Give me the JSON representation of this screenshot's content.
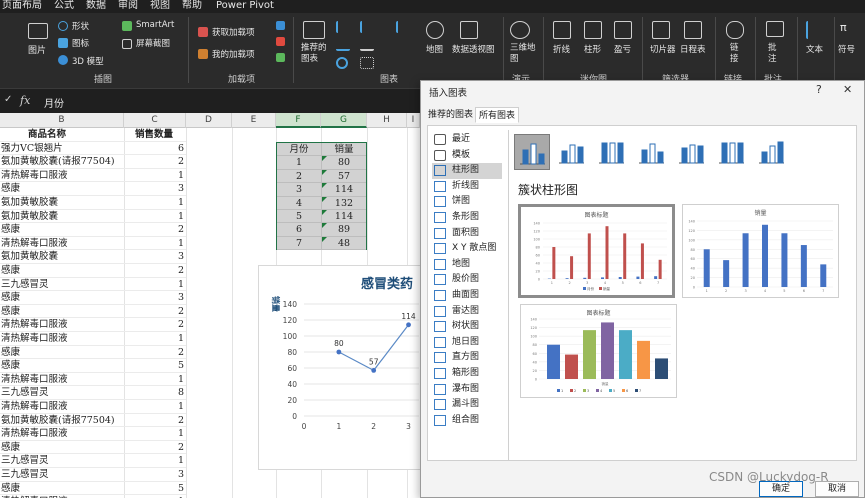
{
  "menu": {
    "tabs": [
      "页面布局",
      "公式",
      "数据",
      "审阅",
      "视图",
      "帮助",
      "Power Pivot"
    ]
  },
  "ribbon": {
    "illustrations": {
      "picture": "图片",
      "shapes": "形状",
      "icons": "图标",
      "models3d": "3D 模型",
      "smartart": "SmartArt",
      "screenshot": "屏幕截图",
      "group": "插图"
    },
    "addins": {
      "get": "获取加载项",
      "mine": "我的加载项",
      "group": "加载项"
    },
    "charts": {
      "recommended": "推荐的\n图表",
      "map": "地图",
      "pivot": "数据透视图",
      "group": "图表"
    },
    "tours": {
      "map3d": "三维地\n图",
      "group": "演示"
    },
    "sparklines": {
      "line": "折线",
      "column": "柱形",
      "winloss": "盈亏",
      "group": "迷你图"
    },
    "filters": {
      "slicer": "切片器",
      "timeline": "日程表",
      "group": "筛选器"
    },
    "links": {
      "link": "链\n接",
      "group": "链接"
    },
    "comments": {
      "comment": "批\n注",
      "group": "批注"
    },
    "text": {
      "text": "文本",
      "group": ""
    },
    "symbols": {
      "symbol": "符号"
    }
  },
  "formula": {
    "value": "月份",
    "fx": "fx"
  },
  "columns": [
    "B",
    "C",
    "D",
    "E",
    "F",
    "G",
    "H",
    "I"
  ],
  "tableA": {
    "header": {
      "name": "商品名称",
      "count": "销售数量"
    },
    "rows": [
      {
        "name": "强力VC银翘片",
        "count": "6"
      },
      {
        "name": "氨加黄敏胶囊(请报77504)",
        "count": "2"
      },
      {
        "name": "清热解毒口服液",
        "count": "1"
      },
      {
        "name": "感康",
        "count": "3"
      },
      {
        "name": "氨加黄敏胶囊",
        "count": "1"
      },
      {
        "name": "氨加黄敏胶囊",
        "count": "1"
      },
      {
        "name": "感康",
        "count": "2"
      },
      {
        "name": "清热解毒口服液",
        "count": "1"
      },
      {
        "name": "氨加黄敏胶囊",
        "count": "3"
      },
      {
        "name": "感康",
        "count": "2"
      },
      {
        "name": "三九感冒灵",
        "count": "1"
      },
      {
        "name": "感康",
        "count": "3"
      },
      {
        "name": "感康",
        "count": "2"
      },
      {
        "name": "清热解毒口服液",
        "count": "2"
      },
      {
        "name": "清热解毒口服液",
        "count": "1"
      },
      {
        "name": "感康",
        "count": "2"
      },
      {
        "name": "感康",
        "count": "5"
      },
      {
        "name": "清热解毒口服液",
        "count": "1"
      },
      {
        "name": "三九感冒灵",
        "count": "8"
      },
      {
        "name": "清热解毒口服液",
        "count": "1"
      },
      {
        "name": "氨加黄敏胶囊(请报77504)",
        "count": "2"
      },
      {
        "name": "清热解毒口服液",
        "count": "1"
      },
      {
        "name": "感康",
        "count": "2"
      },
      {
        "name": "三九感冒灵",
        "count": "1"
      },
      {
        "name": "三九感冒灵",
        "count": "3"
      },
      {
        "name": "感康",
        "count": "5"
      },
      {
        "name": "清热解毒口服液",
        "count": "1"
      }
    ]
  },
  "tableF": {
    "header": {
      "month": "月份",
      "sales": "销量"
    },
    "rows": [
      {
        "month": "1",
        "sales": "80"
      },
      {
        "month": "2",
        "sales": "57"
      },
      {
        "month": "3",
        "sales": "114"
      },
      {
        "month": "4",
        "sales": "132"
      },
      {
        "month": "5",
        "sales": "114"
      },
      {
        "month": "6",
        "sales": "89"
      },
      {
        "month": "7",
        "sales": "48"
      }
    ]
  },
  "embedded_chart": {
    "title": "感冒类药",
    "ylabel": "销量",
    "yticks": [
      "140",
      "120",
      "100",
      "80",
      "60",
      "40",
      "20",
      "0"
    ],
    "xticks": [
      "0",
      "1",
      "2",
      "3"
    ]
  },
  "chart_data": {
    "type": "line",
    "title": "感冒类药",
    "ylabel": "销量",
    "xlabel": "",
    "x": [
      1,
      2,
      3
    ],
    "values": [
      80,
      57,
      114
    ],
    "ylim": [
      0,
      140
    ],
    "xlim": [
      0,
      3.3
    ],
    "grid": true
  },
  "dialog": {
    "title": "插入图表",
    "help": "?",
    "close": "✕",
    "tabs": [
      "推荐的图表",
      "所有图表"
    ],
    "types": [
      "最近",
      "模板",
      "柱形图",
      "折线图",
      "饼图",
      "条形图",
      "面积图",
      "X Y 散点图",
      "地图",
      "股价图",
      "曲面图",
      "雷达图",
      "树状图",
      "旭日图",
      "直方图",
      "箱形图",
      "瀑布图",
      "漏斗图",
      "组合图"
    ],
    "subtype_title": "簇状柱形图",
    "preview1_title": "图表标题",
    "preview2_title": "销量",
    "preview3_title": "图表标题",
    "preview1_legend": [
      "月份",
      "销量"
    ],
    "preview3_axis": "销量",
    "ok": "确定",
    "cancel": "取消"
  },
  "preview_values": [
    80,
    57,
    114,
    132,
    114,
    89,
    48
  ],
  "preview_categories": [
    "1",
    "2",
    "3",
    "4",
    "5",
    "6",
    "7"
  ],
  "preview3_colors": [
    "#4472c4",
    "#c0504d",
    "#9bbb59",
    "#8064a2",
    "#4bacc6",
    "#f79646",
    "#2c4d75"
  ],
  "watermark": "CSDN @Luckydog-R"
}
